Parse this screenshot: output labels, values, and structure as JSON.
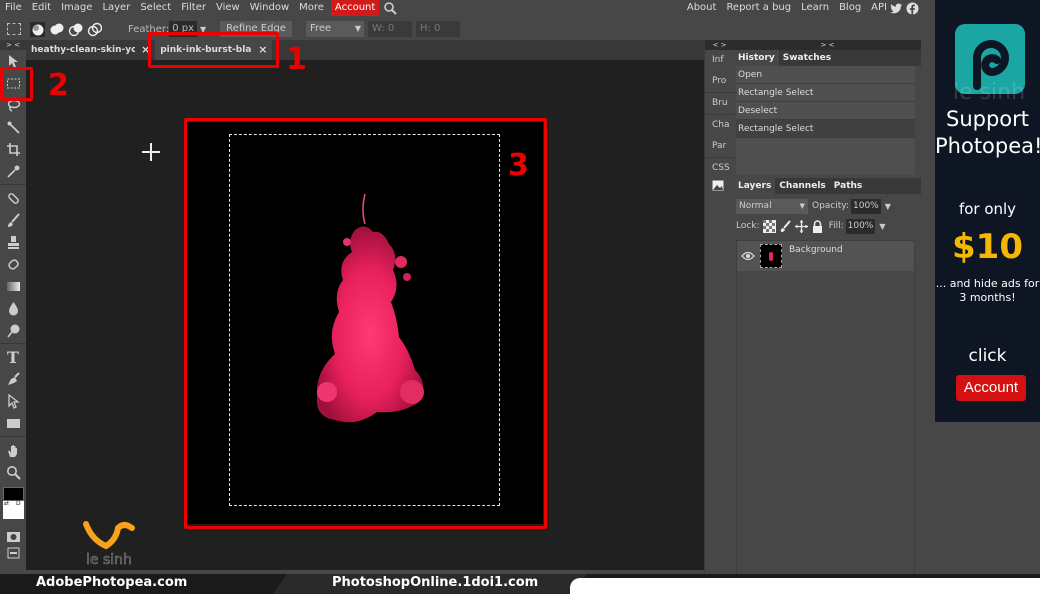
{
  "menu": {
    "items": [
      "File",
      "Edit",
      "Image",
      "Layer",
      "Select",
      "Filter",
      "View",
      "Window",
      "More"
    ],
    "account": "Account",
    "right_links": [
      "About",
      "Report a bug",
      "Learn",
      "Blog",
      "API"
    ]
  },
  "options": {
    "feather_label": "Feather:",
    "feather_value": "0 px",
    "refine_edge": "Refine Edge",
    "style_select": "Free",
    "w_label": "W: 0",
    "h_label": "H: 0"
  },
  "tabs": [
    {
      "name": "heathy-clean-skin-yo",
      "close": "×"
    },
    {
      "name": "pink-ink-burst-black",
      "close": "×",
      "active": true
    }
  ],
  "annotations": [
    "1",
    "2",
    "3"
  ],
  "side_column": {
    "items": [
      "Inf",
      "Pro",
      "Bru",
      "Cha",
      "Par",
      "CSS"
    ]
  },
  "history_panel": {
    "tabs": [
      "History",
      "Swatches"
    ],
    "entries": [
      "Open",
      "Rectangle Select",
      "Deselect",
      "Rectangle Select"
    ]
  },
  "layers_panel": {
    "tabs": [
      "Layers",
      "Channels",
      "Paths"
    ],
    "blend_mode": "Normal",
    "opacity_label": "Opacity:",
    "opacity_value": "100%",
    "lock_label": "Lock:",
    "fill_label": "Fill:",
    "fill_value": "100%",
    "layers": [
      {
        "name": "Background"
      }
    ]
  },
  "ad": {
    "watermark": "le sinh",
    "line1": "Support Photopea!",
    "line2": "for only",
    "price": "$10",
    "line3": "... and hide ads for 3 months!",
    "line4": "click",
    "button": "Account"
  },
  "footer": {
    "left": "AdobePhotopea.com",
    "right": "PhotoshopOnline.1doi1.com",
    "brand": "le sinh"
  },
  "colors": {
    "accent_red": "#d31a1a",
    "annotation_red": "#ee0000",
    "ad_price": "#f5b800",
    "ad_logo": "#1ba5a3"
  }
}
